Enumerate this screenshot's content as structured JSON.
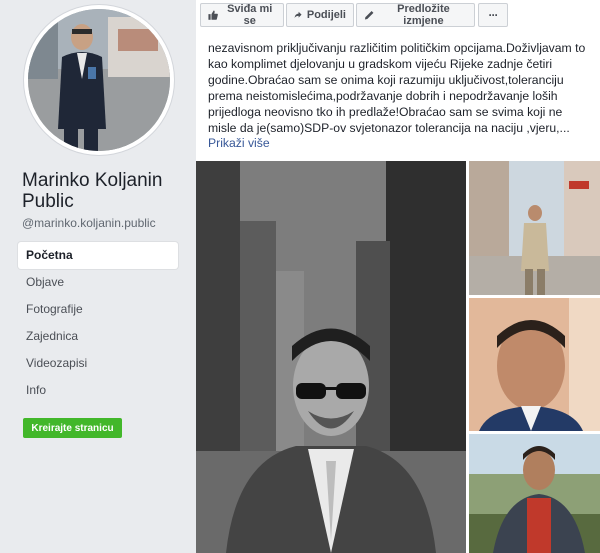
{
  "sidebar": {
    "page_name": "Marinko Koljanin Public",
    "handle": "@marinko.koljanin.public",
    "nav": [
      {
        "label": "Početna",
        "active": true
      },
      {
        "label": "Objave",
        "active": false
      },
      {
        "label": "Fotografije",
        "active": false
      },
      {
        "label": "Zajednica",
        "active": false
      },
      {
        "label": "Videozapisi",
        "active": false
      },
      {
        "label": "Info",
        "active": false
      }
    ],
    "create_page_label": "Kreirajte stranicu"
  },
  "actionbar": {
    "like_label": "Sviđa mi se",
    "share_label": "Podijeli",
    "suggest_label": "Predložite izmjene",
    "more_label": "···"
  },
  "post": {
    "text": "nezavisnom priključivanju različitim političkim opcijama.Doživljavam to kao komplimet djelovanju u gradskom vijeću Rijeke zadnje četiri godine.Obraćao sam se onima koji razumiju uključivost,toleranciju prema neistomislećima,podržavanje dobrih i nepodržavanje loših prijedloga neovisno tko ih predlaže!Obraćao sam se svima koji ne misle da je(samo)SDP-ov svjetonazor tolerancija na naciju ,vjeru,...",
    "see_more": "Prikaži više"
  },
  "colors": {
    "link": "#385898",
    "create_button": "#42b72a",
    "background": "#e9ebee"
  },
  "icons": {
    "like": "thumbs-up-icon",
    "share": "share-arrow-icon",
    "suggest": "pencil-icon",
    "more": "ellipsis-icon"
  }
}
